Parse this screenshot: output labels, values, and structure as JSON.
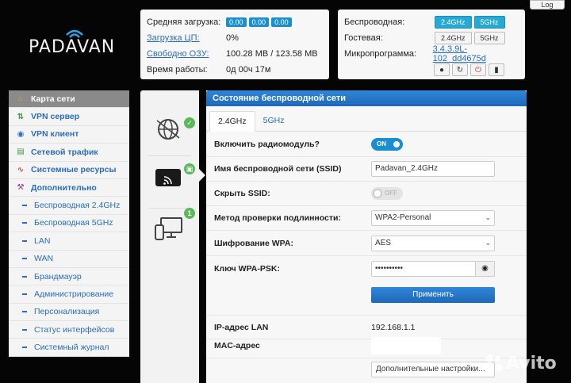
{
  "brand": {
    "logo": "PADAVAN"
  },
  "top_stats": {
    "load_label": "Средняя загрузка:",
    "load_values": [
      "0.00",
      "0.00",
      "0.00"
    ],
    "cpu_label": "Загрузка ЦП:",
    "cpu_value": "0%",
    "ram_label": "Свободно ОЗУ:",
    "ram_value": "100.28 MB / 123.58 MB",
    "uptime_label": "Время работы:",
    "uptime_value": "0д 00ч 17м"
  },
  "sys_panel": {
    "wireless_label": "Беспроводная:",
    "guest_label": "Гостевая:",
    "firmware_label": "Микропрограмма:",
    "firmware_value": "3.4.3.9L-102_dd4675d",
    "band_24": "2.4GHz",
    "band_5": "5GHz"
  },
  "log_button": "Log",
  "sidebar": {
    "items": [
      {
        "label": "Карта сети",
        "icon": "home-icon"
      },
      {
        "label": "VPN сервер",
        "icon": "vpn-server-icon"
      },
      {
        "label": "VPN клиент",
        "icon": "globe-icon"
      },
      {
        "label": "Сетевой трафик",
        "icon": "traffic-icon"
      },
      {
        "label": "Системные ресурсы",
        "icon": "resources-icon"
      },
      {
        "label": "Дополнительно",
        "icon": "wrench-icon"
      }
    ],
    "sub_items": [
      "Беспроводная 2.4GHz",
      "Беспроводная 5GHz",
      "LAN",
      "WAN",
      "Брандмауэр",
      "Администрирование",
      "Персонализация",
      "Статус интерфейсов",
      "Системный журнал"
    ]
  },
  "iconbar": {
    "clients_count": "1"
  },
  "main": {
    "title": "Состояние беспроводной сети",
    "tabs": [
      "2.4GHz",
      "5GHz"
    ],
    "rows": {
      "radio_label": "Включить радиомодуль?",
      "radio_state": "ON",
      "ssid_label": "Имя беспроводной сети (SSID)",
      "ssid_value": "Padavan_2.4GHz",
      "hide_label": "Скрыть SSID:",
      "hide_state": "OFF",
      "auth_label": "Метод проверки подлинности:",
      "auth_value": "WPA2-Personal",
      "wpa_label": "Шифрование WPA:",
      "wpa_value": "AES",
      "psk_label": "Ключ WPA-PSK:",
      "psk_value": "••••••••••",
      "apply": "Применить",
      "ip_label": "IP-адрес LAN",
      "ip_value": "192.168.1.1",
      "mac_label": "MAC-адрес",
      "advanced": "Дополнительные настройки..."
    }
  },
  "watermark": "Avito"
}
